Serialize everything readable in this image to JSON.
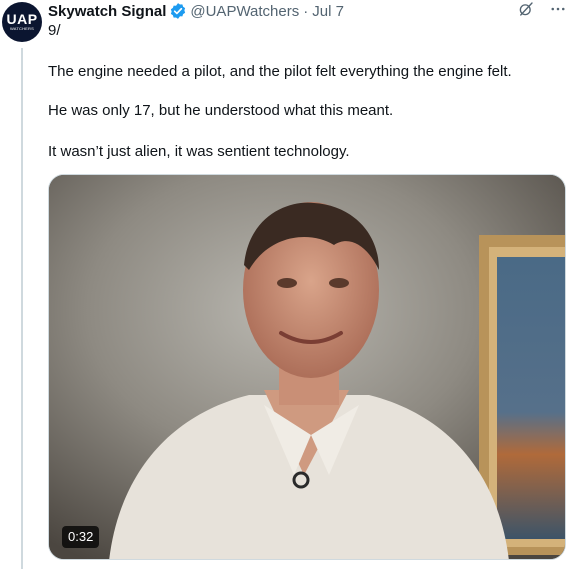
{
  "account": {
    "avatar_text": "UAP",
    "avatar_subtext": "WATCHERS",
    "display_name": "Skywatch Signal",
    "handle": "@UAPWatchers",
    "separator": "·",
    "date": "Jul 7",
    "verified_icon": "verified-badge-icon"
  },
  "actions": {
    "grok_icon": "grok-icon",
    "more_icon": "more-icon"
  },
  "post": {
    "thread_number": "9/",
    "paragraphs": [
      "The engine needed a pilot, and the pilot felt everything the engine felt.",
      "He was only 17, but he understood what this meant.",
      "It wasn’t just alien, it was sentient technology."
    ]
  },
  "media": {
    "type": "video",
    "duration": "0:32"
  },
  "colors": {
    "text": "#0f1419",
    "secondary": "#536471",
    "verified": "#1d9bf0",
    "thread_line": "#cfd9de"
  }
}
